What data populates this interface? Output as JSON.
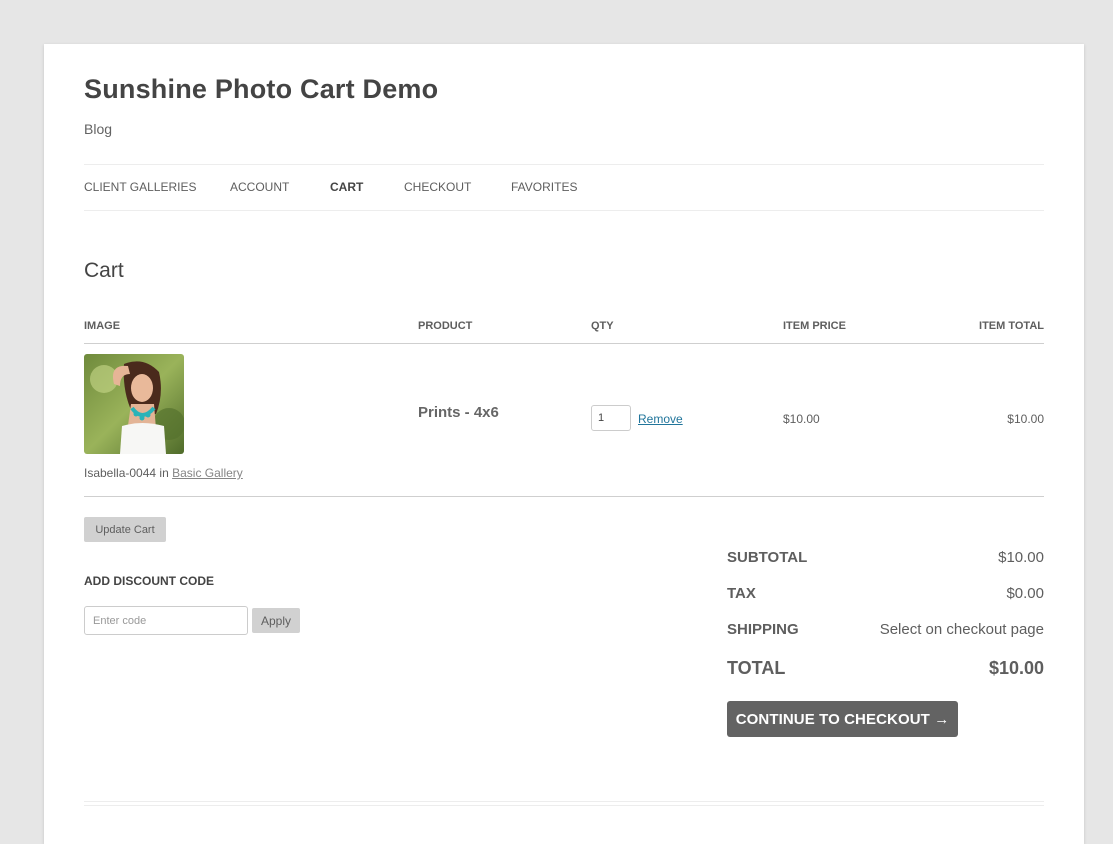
{
  "site": {
    "title": "Sunshine Photo Cart Demo",
    "description": "Blog"
  },
  "nav": {
    "items": [
      {
        "label": "CLIENT GALLERIES"
      },
      {
        "label": "ACCOUNT"
      },
      {
        "label": "CART",
        "active": true
      },
      {
        "label": "CHECKOUT"
      },
      {
        "label": "FAVORITES"
      }
    ]
  },
  "page": {
    "title": "Cart"
  },
  "cart_table": {
    "headers": {
      "image": "IMAGE",
      "product": "PRODUCT",
      "qty": "QTY",
      "item_price": "ITEM PRICE",
      "item_total": "ITEM TOTAL"
    },
    "rows": [
      {
        "image_name": "Isabella-0044",
        "in_text": "in",
        "gallery": "Basic Gallery",
        "product": "Prints - 4x6",
        "qty": "1",
        "remove_label": "Remove",
        "item_price": "$10.00",
        "item_total": "$10.00"
      }
    ]
  },
  "actions": {
    "update_cart": "Update Cart"
  },
  "discount": {
    "heading": "ADD DISCOUNT CODE",
    "placeholder": "Enter code",
    "apply_label": "Apply"
  },
  "summary": {
    "subtotal_label": "SUBTOTAL",
    "subtotal_value": "$10.00",
    "tax_label": "TAX",
    "tax_value": "$0.00",
    "shipping_label": "SHIPPING",
    "shipping_value": "Select on checkout page",
    "total_label": "TOTAL",
    "total_value": "$10.00",
    "checkout_label": "CONTINUE TO CHECKOUT →"
  },
  "colors": {
    "page_bg": "#e6e6e6",
    "content_bg": "#ffffff",
    "link": "#21759b",
    "checkout_button": "#636363",
    "secondary_button": "#d1d1d1"
  }
}
